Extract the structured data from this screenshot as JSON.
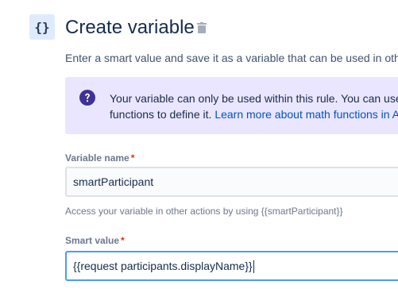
{
  "header": {
    "icon_glyph": "{}",
    "title": "Create variable",
    "delete_icon": "trash-icon",
    "subtitle": "Enter a smart value and save it as a variable that can be used in othe"
  },
  "info_panel": {
    "icon": "question-circle-icon",
    "line1": "Your variable can only be used within this rule. You can use",
    "line2_text": "functions to define it.",
    "line2_link": "Learn more about math functions in A"
  },
  "variable_name": {
    "label": "Variable name",
    "required_mark": "*",
    "value": "smartParticipant",
    "helper": "Access your variable in other actions by using {{smartParticipant}}"
  },
  "smart_value": {
    "label": "Smart value",
    "required_mark": "*",
    "value": "{{request participants.displayName}}"
  },
  "colors": {
    "info_background": "#eae6ff",
    "info_icon": "#403294",
    "link": "#0052cc",
    "required": "#de350b",
    "focus_border": "#4c9aff"
  }
}
